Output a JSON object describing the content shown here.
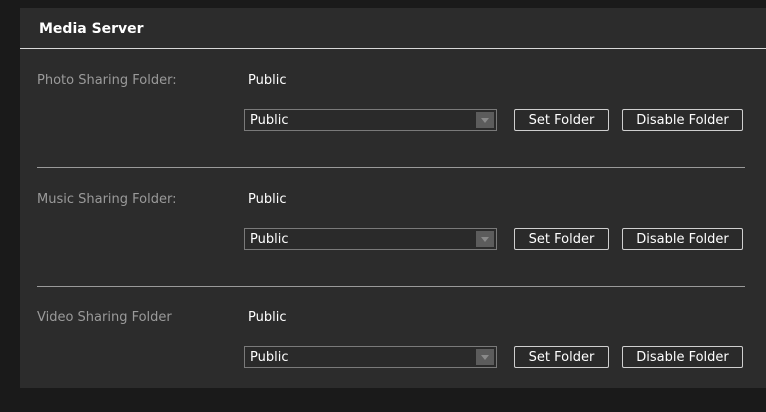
{
  "header": {
    "title": "Media Server"
  },
  "sections": [
    {
      "label": "Photo Sharing Folder:",
      "value": "Public",
      "selected": "Public",
      "set_label": "Set Folder",
      "disable_label": "Disable Folder"
    },
    {
      "label": "Music Sharing Folder:",
      "value": "Public",
      "selected": "Public",
      "set_label": "Set Folder",
      "disable_label": "Disable Folder"
    },
    {
      "label": "Video Sharing Folder",
      "value": "Public",
      "selected": "Public",
      "set_label": "Set Folder",
      "disable_label": "Disable Folder"
    }
  ],
  "icons": {
    "dropdown": "chevron-down-icon"
  },
  "colors": {
    "background": "#2c2c2c",
    "text": "#ffffff",
    "label": "#9a9a9a",
    "border": "#cfcfcf"
  }
}
